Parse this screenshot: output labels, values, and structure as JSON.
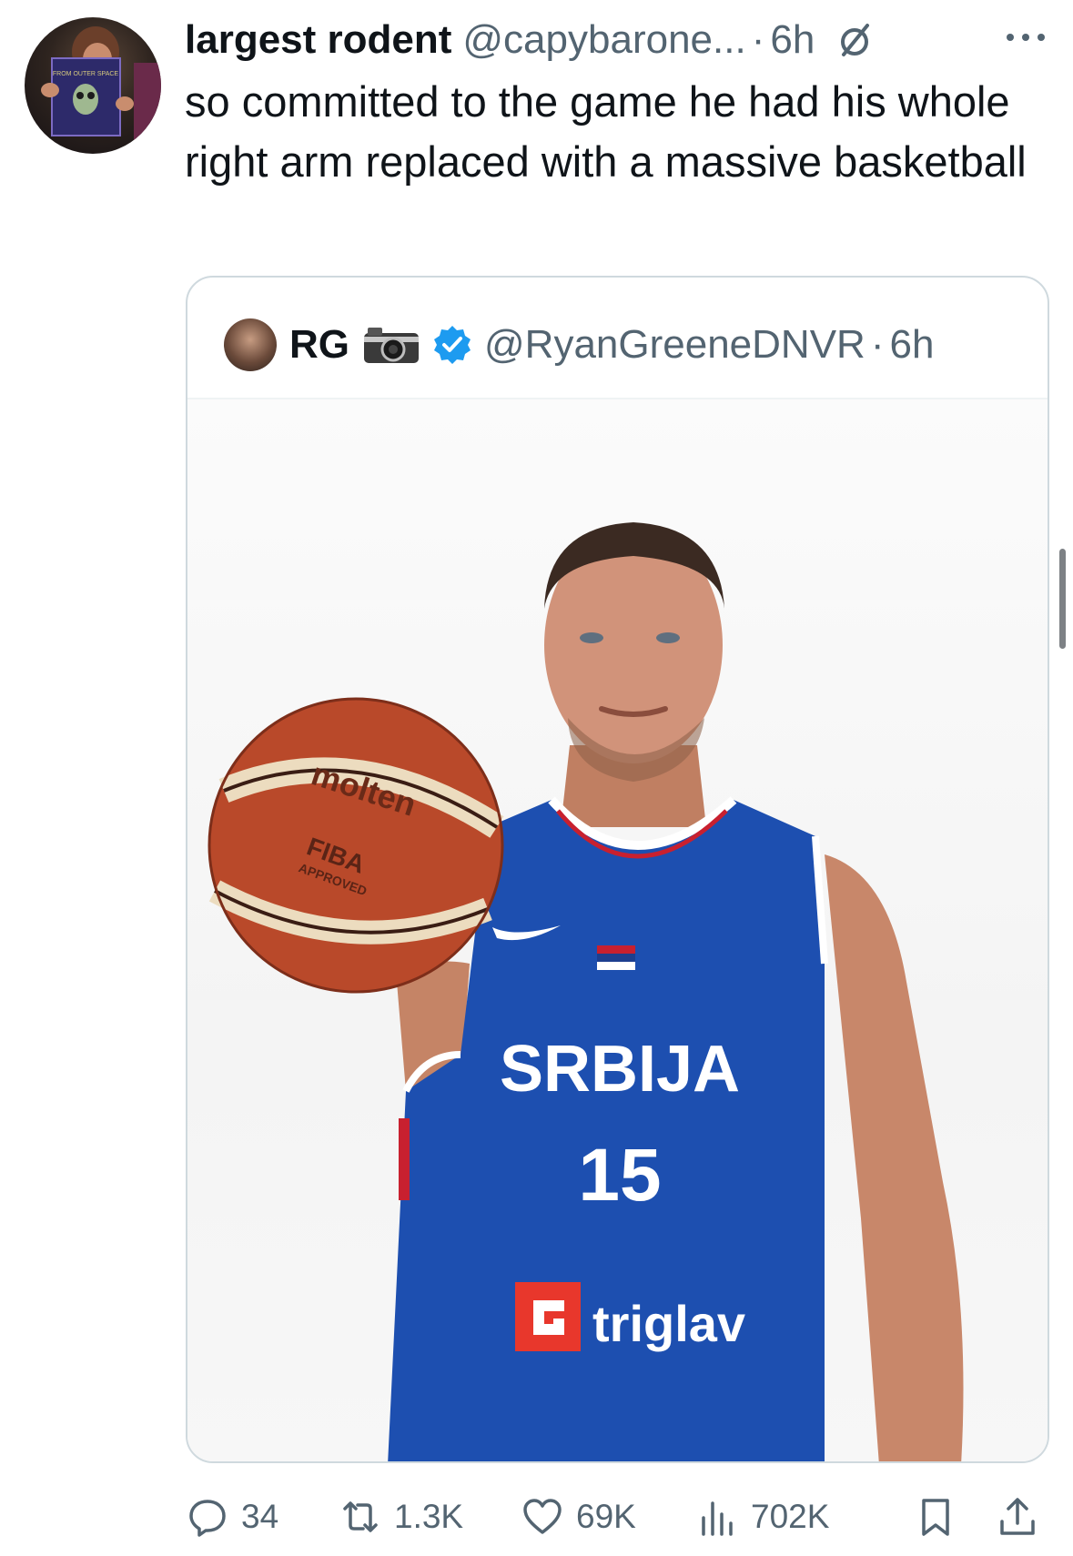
{
  "tweet": {
    "author_name": "largest rodent",
    "author_handle": "@capybarone...",
    "separator": "·",
    "time": "6h",
    "text": "so committed to the game he had his whole right arm replaced with a massive basketball",
    "avatar_book_text": "FROM OUTER SPACE"
  },
  "quote": {
    "author_name": "RG",
    "author_handle": "@RyanGreeneDNVR",
    "separator": "·",
    "time": "6h",
    "verified_color": "#1d9bf0",
    "photo": {
      "ball_brand": "molten",
      "ball_text_1": "FIBA",
      "ball_text_2": "APPROVED",
      "jersey_text": "SRBIJA",
      "jersey_number": "15",
      "sponsor": "triglav"
    }
  },
  "actions": {
    "replies": "34",
    "reposts": "1.3K",
    "likes": "69K",
    "views": "702K"
  },
  "icons": [
    "status-slash-icon",
    "more-icon",
    "camera-icon",
    "verified-icon",
    "reply-icon",
    "repost-icon",
    "like-icon",
    "views-icon",
    "bookmark-icon",
    "share-icon"
  ],
  "colors": {
    "text": "#0f1419",
    "secondary": "#536471",
    "border": "#cfd9de",
    "jersey_blue": "#1d4fb0",
    "ball_orange": "#b9492a"
  }
}
